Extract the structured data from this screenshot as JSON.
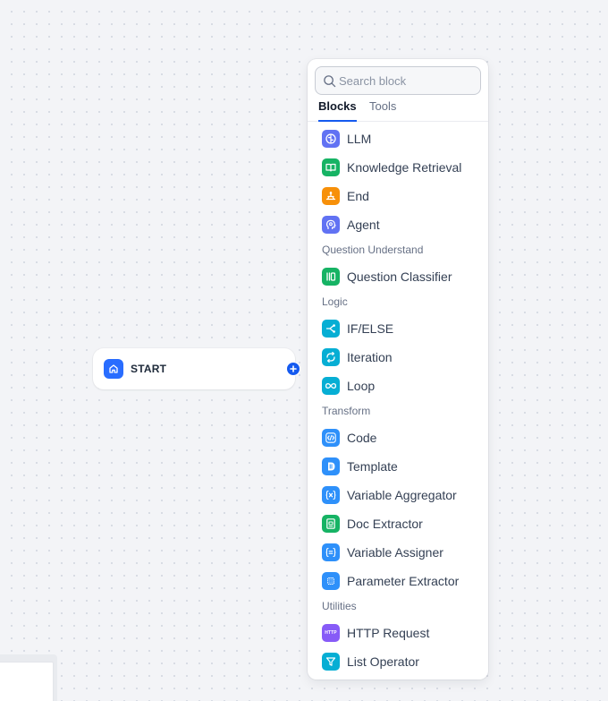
{
  "start_node": {
    "label": "START"
  },
  "block_selector": {
    "search_placeholder": "Search block",
    "tabs": {
      "blocks": "Blocks",
      "tools": "Tools"
    },
    "items": {
      "llm": "LLM",
      "knowledge_retrieval": "Knowledge Retrieval",
      "end": "End",
      "agent": "Agent",
      "question_classifier": "Question Classifier",
      "if_else": "IF/ELSE",
      "iteration": "Iteration",
      "loop": "Loop",
      "code": "Code",
      "template": "Template",
      "variable_aggregator": "Variable Aggregator",
      "doc_extractor": "Doc Extractor",
      "variable_assigner": "Variable Assigner",
      "parameter_extractor": "Parameter Extractor",
      "http_request": "HTTP Request",
      "list_operator": "List Operator"
    },
    "sections": {
      "question_understand": "Question Understand",
      "logic": "Logic",
      "transform": "Transform",
      "utilities": "Utilities"
    },
    "http_icon_text": "HTTP"
  },
  "colors": {
    "indigo": "#6172f3",
    "green": "#16b364",
    "orange": "#f79009",
    "cyan": "#06aed4",
    "blue": "#2e90fa",
    "violet": "#875bf7",
    "accent": "#155aef"
  },
  "icons": {
    "start": "home-icon",
    "llm": "brain-icon",
    "knowledge_retrieval": "book-icon",
    "end": "stop-icon",
    "agent": "agent-head-icon",
    "question_classifier": "classifier-icon",
    "if_else": "branch-icon",
    "iteration": "repeat-icon",
    "loop": "infinity-icon",
    "code": "code-icon",
    "template": "template-icon",
    "variable_aggregator": "variable-icon",
    "doc_extractor": "document-icon",
    "variable_assigner": "assign-icon",
    "parameter_extractor": "grid-icon",
    "http_request": "http-icon",
    "list_operator": "filter-icon"
  }
}
